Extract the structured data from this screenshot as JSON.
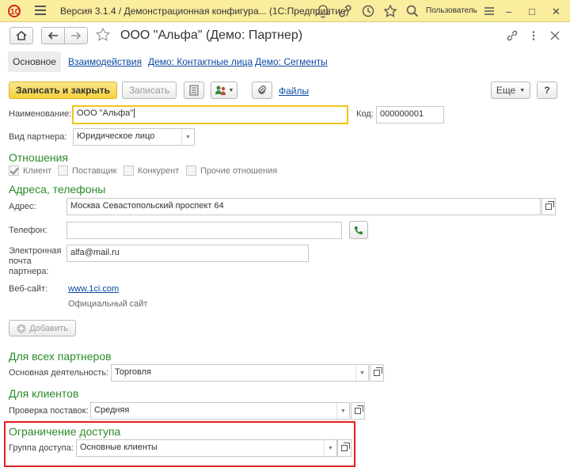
{
  "titlebar": {
    "logo_text": "1С",
    "title": "Версия 3.1.4 / Демонстрационная конфигура... (1С:Предприятие)",
    "user": "Пользователь"
  },
  "form": {
    "title": "ООО \"Альфа\" (Демо: Партнер)"
  },
  "tabs": [
    {
      "label": "Основное",
      "active": true
    },
    {
      "label": "Взаимодействия",
      "active": false
    },
    {
      "label": "Демо: Контактные лица",
      "active": false
    },
    {
      "label": "Демо: Сегменты",
      "active": false
    }
  ],
  "toolbar": {
    "save_close_label": "Записать и закрыть",
    "save_label": "Записать",
    "files_label": "Файлы",
    "more_label": "Еще",
    "help_label": "?"
  },
  "fields": {
    "name_label": "Наименование:",
    "name_value": "ООО \"Альфа\"",
    "code_label": "Код:",
    "code_value": "000000001",
    "partner_type_label": "Вид партнера:",
    "partner_type_value": "Юридическое лицо"
  },
  "relations": {
    "heading": "Отношения",
    "items": [
      {
        "label": "Клиент",
        "checked": true
      },
      {
        "label": "Поставщик",
        "checked": false
      },
      {
        "label": "Конкурент",
        "checked": false
      },
      {
        "label": "Прочие отношения",
        "checked": false
      }
    ]
  },
  "contacts": {
    "heading": "Адреса, телефоны",
    "address_label": "Адрес:",
    "address_value": "Москва Севастопольский проспект 64",
    "phone_label": "Телефон:",
    "phone_value": "",
    "email_label_1": "Электронная",
    "email_label_2": "почта",
    "email_label_3": "партнера:",
    "email_value": "alfa@mail.ru",
    "website_label": "Веб-сайт:",
    "website_value": "www.1ci.com",
    "website_hint": "Официальный сайт",
    "add_label": "Добавить"
  },
  "all_partners": {
    "heading": "Для всех партнеров",
    "activity_label": "Основная деятельность:",
    "activity_value": "Торговля"
  },
  "clients": {
    "heading": "Для клиентов",
    "check_label": "Проверка поставок:",
    "check_value": "Средняя"
  },
  "access": {
    "heading": "Ограничение доступа",
    "group_label": "Группа доступа:",
    "group_value": "Основные клиенты",
    "highlight_color": "#e32020"
  },
  "colors": {
    "titlebar": "#fbed9e",
    "section": "#2a8a2a",
    "link": "#0c4aa2",
    "primary_button": "#f5d13c"
  }
}
